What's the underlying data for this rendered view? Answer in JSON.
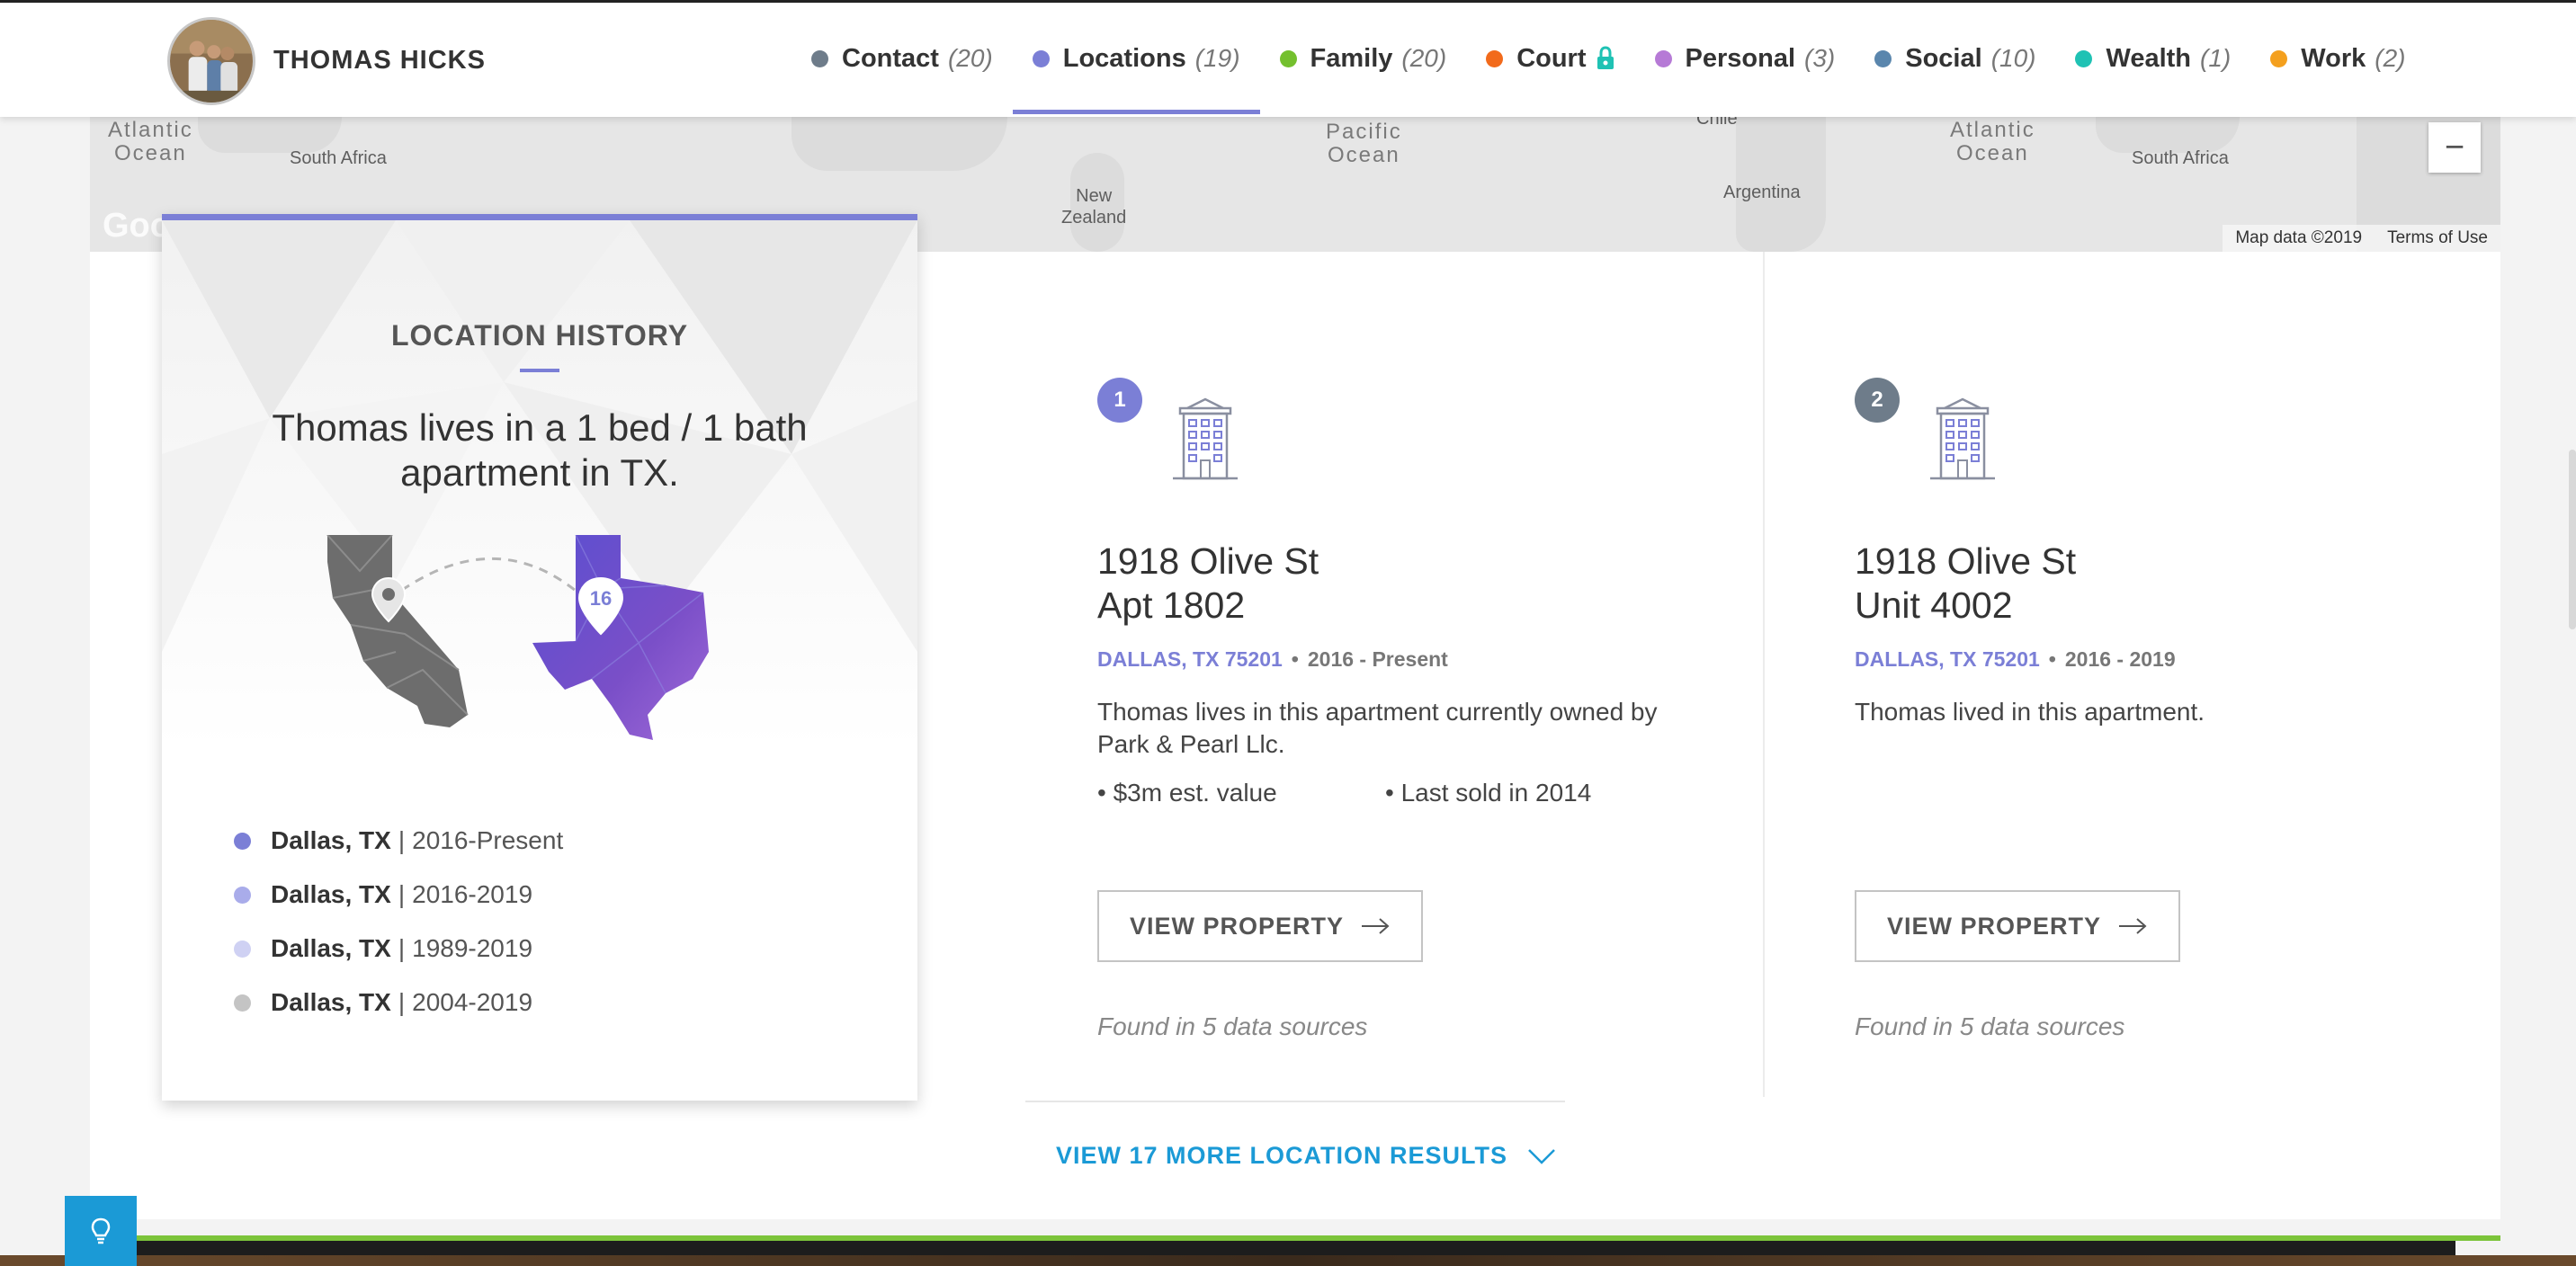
{
  "header": {
    "name": "THOMAS HICKS",
    "nav": [
      {
        "label": "Contact",
        "count": "(20)",
        "color": "#6e7c8a",
        "active": false,
        "locked": false
      },
      {
        "label": "Locations",
        "count": "(19)",
        "color": "#7b7fd6",
        "active": true,
        "locked": false
      },
      {
        "label": "Family",
        "count": "(20)",
        "color": "#74c02e",
        "active": false,
        "locked": false
      },
      {
        "label": "Court",
        "count": "",
        "color": "#f26a1b",
        "active": false,
        "locked": true
      },
      {
        "label": "Personal",
        "count": "(3)",
        "color": "#b67ad6",
        "active": false,
        "locked": false
      },
      {
        "label": "Social",
        "count": "(10)",
        "color": "#5a86ad",
        "active": false,
        "locked": false
      },
      {
        "label": "Wealth",
        "count": "(1)",
        "color": "#1fc2b4",
        "active": false,
        "locked": false
      },
      {
        "label": "Work",
        "count": "(2)",
        "color": "#f4a01e",
        "active": false,
        "locked": false
      }
    ]
  },
  "map": {
    "labels": [
      "Atlantic\nOcean",
      "South Africa",
      "New\nZealand",
      "South\nPacific\nOcean",
      "Chile",
      "Argentina",
      "Atlantic\nOcean",
      "South Africa"
    ],
    "logo": "Goo",
    "zoom_out": "−",
    "footer_data": "Map data ©2019",
    "footer_terms": "Terms of Use"
  },
  "history": {
    "title": "LOCATION HISTORY",
    "summary": "Thomas lives in a 1 bed / 1 bath apartment in TX.",
    "pin_count": "16",
    "locations": [
      {
        "city": "Dallas, TX",
        "years": "2016-Present",
        "color": "#7b7fd6"
      },
      {
        "city": "Dallas, TX",
        "years": "2016-2019",
        "color": "#a9acea"
      },
      {
        "city": "Dallas, TX",
        "years": "1989-2019",
        "color": "#cfd1f3"
      },
      {
        "city": "Dallas, TX",
        "years": "2004-2019",
        "color": "#c4c4c4"
      }
    ],
    "separator": "|"
  },
  "properties": [
    {
      "number": "1",
      "number_color": "#7b7fd6",
      "address_line1": "1918 Olive St",
      "address_line2": "Apt 1802",
      "city": "DALLAS, TX 75201",
      "years": "2016 - Present",
      "description": "Thomas lives in this apartment currently owned by Park & Pearl Llc.",
      "facts": [
        "• $3m est. value",
        "• Last sold in 2014"
      ],
      "button": "VIEW PROPERTY",
      "found": "Found in 5 data sources"
    },
    {
      "number": "2",
      "number_color": "#6e7c8a",
      "address_line1": "1918 Olive St",
      "address_line2": "Unit 4002",
      "city": "DALLAS, TX 75201",
      "years": "2016 - 2019",
      "description": "Thomas lived in this apartment.",
      "facts": [],
      "button": "VIEW PROPERTY",
      "found": "Found in 5 data sources"
    }
  ],
  "more": {
    "label": "VIEW 17 MORE LOCATION RESULTS"
  },
  "meta_sep": "•",
  "colors": {
    "accent": "#7b7fd6",
    "link": "#1b9ad6",
    "green": "#7cc43a"
  }
}
